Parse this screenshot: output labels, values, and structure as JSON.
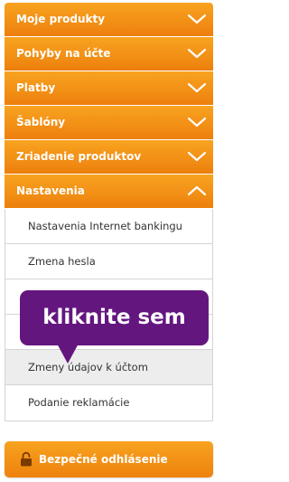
{
  "menu": {
    "sections": [
      {
        "label": "Moje produkty",
        "expanded": false
      },
      {
        "label": "Pohyby na účte",
        "expanded": false
      },
      {
        "label": "Platby",
        "expanded": false
      },
      {
        "label": "Šablóny",
        "expanded": false
      },
      {
        "label": "Zriadenie produktov",
        "expanded": false
      },
      {
        "label": "Nastavenia",
        "expanded": true
      }
    ],
    "submenu": [
      {
        "label": "Nastavenia Internet bankingu"
      },
      {
        "label": "Zmena hesla"
      },
      {
        "label": ""
      },
      {
        "label": ""
      },
      {
        "label": "Zmeny údajov k účtom",
        "active": true
      },
      {
        "label": "Podanie reklamácie"
      }
    ]
  },
  "tooltip": {
    "text": "kliknite sem"
  },
  "logout": {
    "label": "Bezpečné odhlásenie",
    "icon": "padlock-icon"
  },
  "colors": {
    "accent": "#f29016",
    "tooltip": "#64167f",
    "active_row": "#ededed"
  }
}
